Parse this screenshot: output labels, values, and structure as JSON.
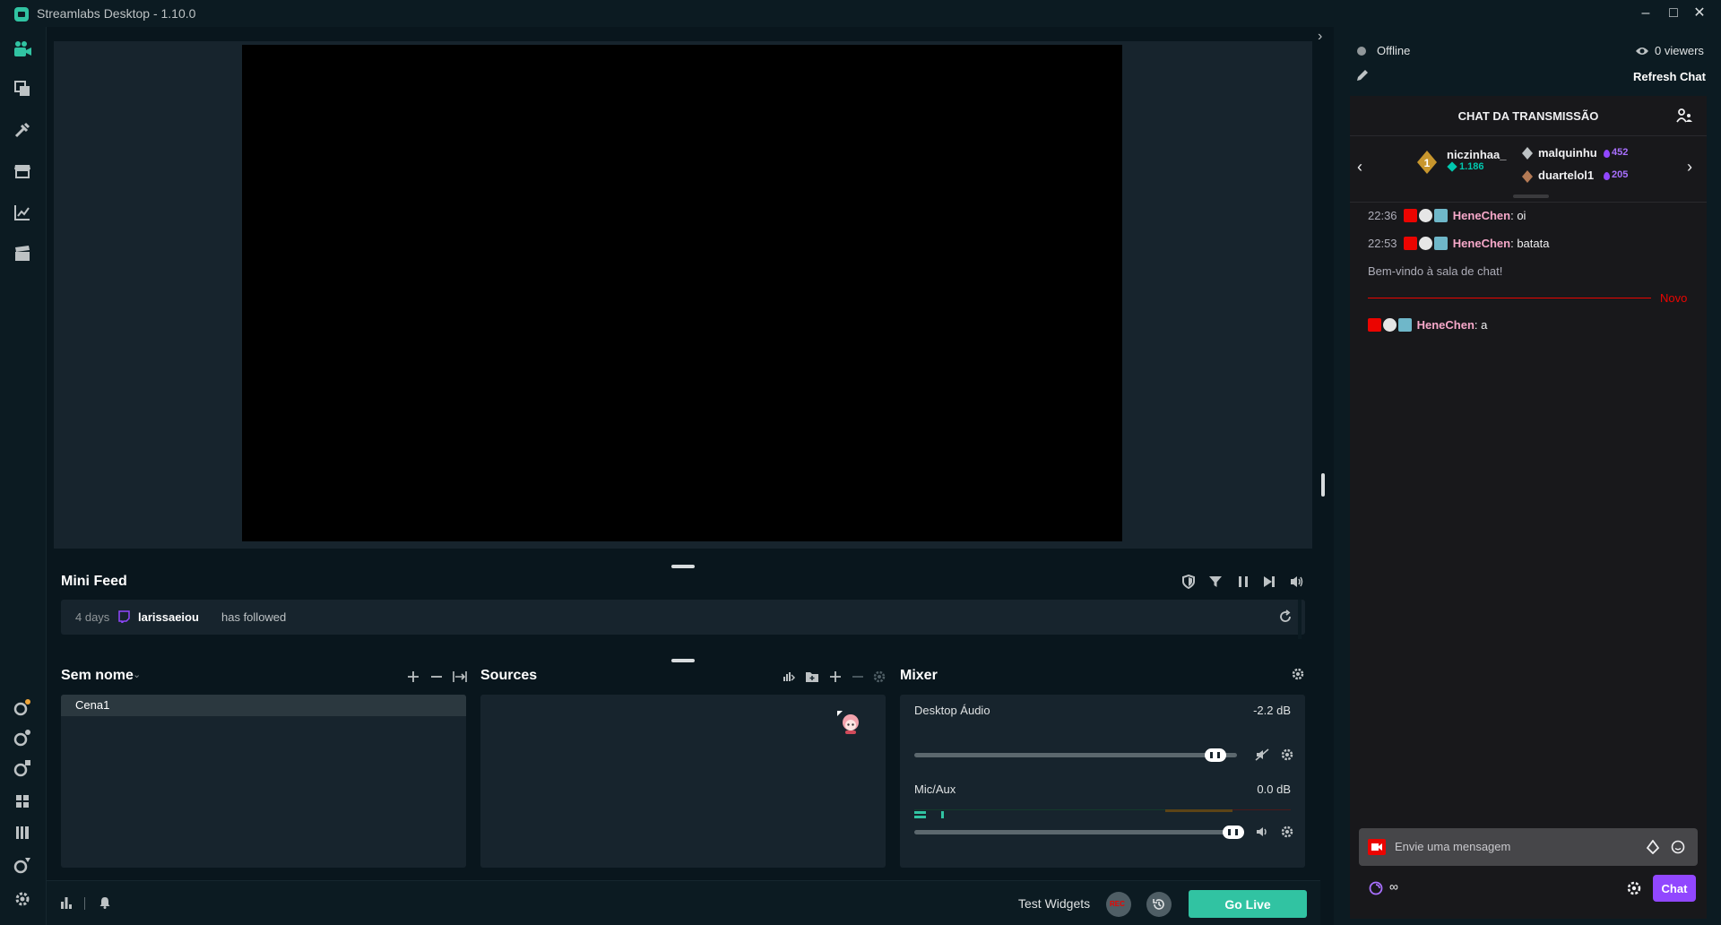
{
  "window": {
    "title": "Streamlabs Desktop - 1.10.0",
    "controls": [
      "minimize",
      "maximize",
      "close"
    ]
  },
  "nav": {
    "top_icons": [
      "video-camera-icon",
      "themes-icon",
      "editor-tools-icon",
      "store-icon",
      "analytics-icon",
      "clapper-icon"
    ],
    "bottom_icons": [
      "app-1-icon",
      "app-2-icon",
      "app-3-icon",
      "grid-icon",
      "layout-icon",
      "app-4-icon",
      "settings-icon"
    ]
  },
  "minifeed": {
    "title": "Mini Feed",
    "entry": {
      "time": "4 days",
      "user": "larissaeiou",
      "action": "has followed"
    }
  },
  "scenes": {
    "collection": "Sem nome",
    "items": [
      "Cena1"
    ]
  },
  "sources": {
    "title": "Sources"
  },
  "mixer": {
    "title": "Mixer",
    "channels": [
      {
        "name": "Desktop Áudio",
        "db": "-2.2 dB",
        "level": 0.95
      },
      {
        "name": "Mic/Aux",
        "db": "0.0 dB",
        "level": 1.0
      }
    ]
  },
  "bottombar": {
    "test_widgets": "Test Widgets",
    "rec": "REC",
    "go_live": "Go Live"
  },
  "chat": {
    "status": "Offline",
    "viewers": "0 viewers",
    "refresh": "Refresh Chat",
    "header": "CHAT DA TRANSMISSÃO",
    "leaderboard": {
      "first": {
        "name": "niczinhaa_",
        "value": "1.186"
      },
      "second": {
        "name": "malquinhu",
        "value": "452"
      },
      "third": {
        "name": "duartelol1",
        "value": "205"
      }
    },
    "messages": [
      {
        "time": "22:36",
        "user": "HeneChen",
        "text": " oi"
      },
      {
        "time": "22:53",
        "user": "HeneChen",
        "text": " batata"
      }
    ],
    "welcome": "Bem-vindo à sala de chat!",
    "new_label": "Novo",
    "new_message": {
      "user": "HeneChen",
      "text": " a"
    },
    "input_placeholder": "Envie uma mensagem",
    "infinity": "∞",
    "send": "Chat"
  },
  "colors": {
    "accent": "#31c3a2",
    "twitch_purple": "#9147ff",
    "live_red": "#eb0400",
    "username_pink": "#f6a8c9"
  }
}
